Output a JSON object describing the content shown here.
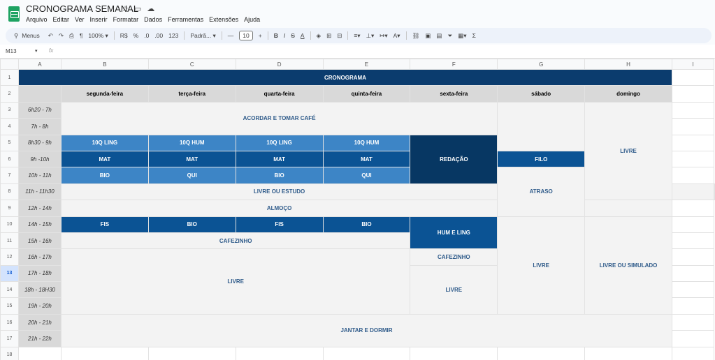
{
  "app": {
    "title": "CRONOGRAMA SEMANAL",
    "menu": [
      "Arquivo",
      "Editar",
      "Ver",
      "Inserir",
      "Formatar",
      "Dados",
      "Ferramentas",
      "Extensões",
      "Ajuda"
    ]
  },
  "toolbar": {
    "menus_label": "Menus",
    "zoom": "100%",
    "currency": "R$",
    "percent": "%",
    "dec_decrease": ".0",
    "dec_increase": ".00",
    "format_123": "123",
    "font": "Padrã...",
    "font_size": "10",
    "minus": "—",
    "plus": "+"
  },
  "formula_bar": {
    "cell_ref": "M13",
    "fx": "fx"
  },
  "columns": [
    "A",
    "B",
    "C",
    "D",
    "E",
    "F",
    "G",
    "H",
    "I"
  ],
  "rows": [
    "1",
    "2",
    "3",
    "4",
    "5",
    "6",
    "7",
    "8",
    "9",
    "10",
    "11",
    "12",
    "13",
    "14",
    "15",
    "16",
    "17",
    "18"
  ],
  "selected_row": "13",
  "sheet": {
    "header": "CRONOGRAMA",
    "days": [
      "segunda-feira",
      "terça-feira",
      "quarta-feira",
      "quinta-feira",
      "sexta-feira",
      "sábado",
      "domingo"
    ],
    "times": [
      "6h20 - 7h",
      "7h - 8h",
      "8h30 - 9h",
      "9h -10h",
      "10h - 11h",
      "11h - 11h30",
      "12h - 14h",
      "14h - 15h",
      "15h - 16h",
      "16h - 17h",
      "17h - 18h",
      "18h - 18H30",
      "19h - 20h",
      "20h - 21h",
      "21h - 22h"
    ],
    "acordar": "ACORDAR E TOMAR CAFÉ",
    "row5": [
      "10Q LING",
      "10Q HUM",
      "10Q LING",
      "10Q HUM"
    ],
    "row6": [
      "MAT",
      "MAT",
      "MAT",
      "MAT"
    ],
    "row7": [
      "BIO",
      "QUI",
      "BIO",
      "QUI"
    ],
    "redacao": "REDAÇÃO",
    "filo": "FILO",
    "livre": "LIVRE",
    "livre_estudo": "LIVRE OU ESTUDO",
    "atraso": "ATRASO",
    "almoco": "ALMOÇO",
    "row10": [
      "FIS",
      "BIO",
      "FIS",
      "BIO"
    ],
    "hum_ling": "HUM E LING",
    "cafezinho": "CAFEZINHO",
    "cafezinho_f": "CAFEZINHO",
    "livre_main": "LIVRE",
    "livre_f": "LIVRE",
    "livre_g": "LIVRE",
    "livre_simulado": "LIVRE OU SIMULADO",
    "jantar": "JANTAR E DORMIR"
  },
  "colors": {
    "header": "#0b3c6e",
    "light_blue": "#3d85c6",
    "mid_blue": "#0b5394",
    "dark_blue": "#073763",
    "grey": "#d9d9d9",
    "light_grey": "#f3f3f3"
  }
}
